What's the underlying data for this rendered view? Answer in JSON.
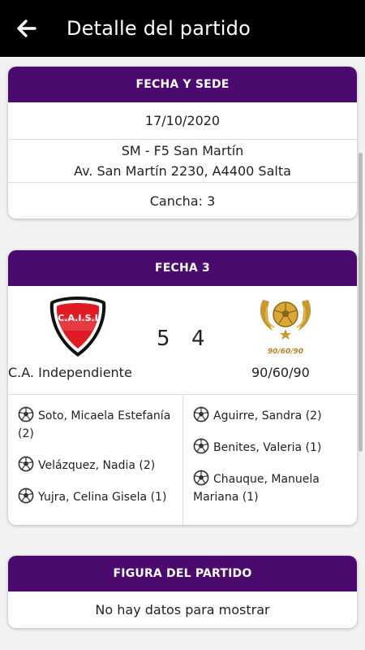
{
  "header": {
    "title": "Detalle del partido",
    "back_icon": "arrow-left-icon"
  },
  "venue": {
    "title": "FECHA Y SEDE",
    "date": "17/10/2020",
    "venue_name": "SM - F5 San Martín",
    "address": "Av. San Martín 2230, A4400 Salta",
    "field": "Cancha: 3"
  },
  "match": {
    "title": "FECHA 3",
    "home": {
      "name": "C.A. Independiente",
      "score": "5",
      "crest_text": "C.A.I.S.I"
    },
    "away": {
      "name": "90/60/90",
      "score": "4",
      "crest_text": "90/60/90"
    },
    "home_scorers": [
      {
        "name": "Soto, Micaela Estefanía (2)"
      },
      {
        "name": "Velázquez, Nadia (2)"
      },
      {
        "name": "Yujra, Celina Gisela (1)"
      }
    ],
    "away_scorers": [
      {
        "name": "Aguirre, Sandra (2)"
      },
      {
        "name": "Benites, Valeria (1)"
      },
      {
        "name": "Chauque, Manuela Mariana (1)"
      }
    ]
  },
  "figure": {
    "title": "FIGURA DEL PARTIDO",
    "empty_text": "No hay datos para mostrar"
  },
  "colors": {
    "accent": "#4b0a6e",
    "appbar": "#000000",
    "crest_red": "#e01b24",
    "gold": "#c9982e"
  }
}
